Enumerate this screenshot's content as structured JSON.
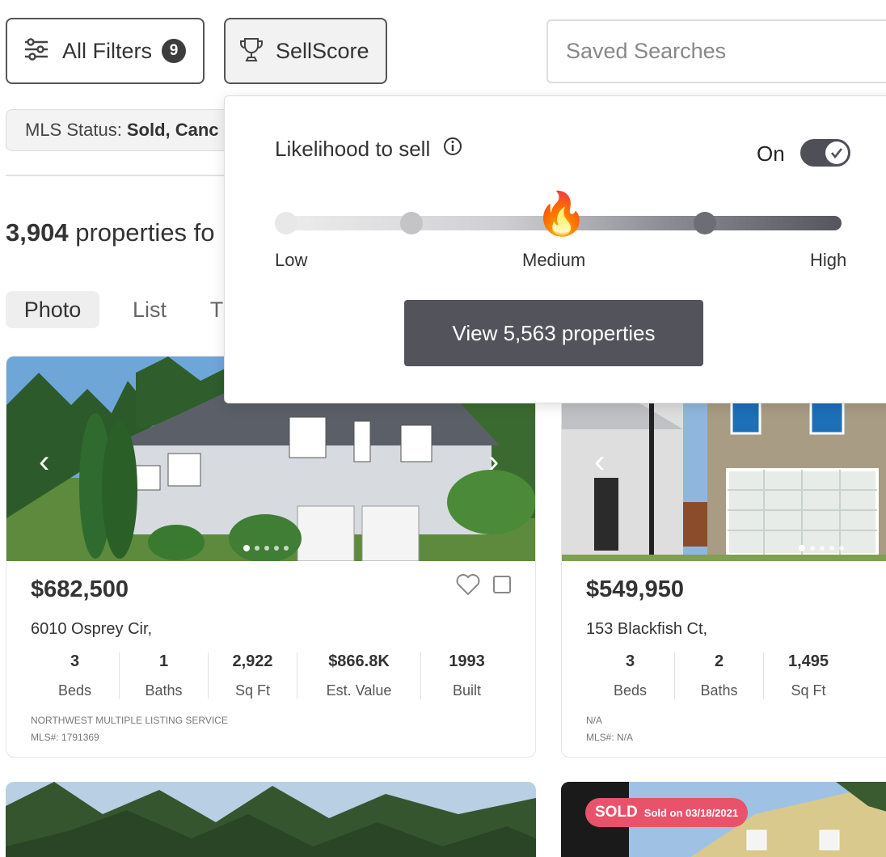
{
  "toolbar": {
    "filters_label": "All Filters",
    "filters_count": "9",
    "sellscore_label": "SellScore",
    "saved_searches_placeholder": "Saved Searches"
  },
  "chips": {
    "mls_status_key": "MLS Status:",
    "mls_status_value": "Sold, Canc"
  },
  "results": {
    "count": "3,904",
    "suffix": "properties fo"
  },
  "view_tabs": [
    "Photo",
    "List",
    "T"
  ],
  "sellscore_popover": {
    "title": "Likelihood to sell",
    "toggle_label": "On",
    "toggle_on": true,
    "slider_labels": {
      "low": "Low",
      "medium": "Medium",
      "high": "High"
    },
    "selected_level": "Medium",
    "view_button": "View 5,563 properties"
  },
  "listings": [
    {
      "price": "$682,500",
      "address": "6010 Osprey Cir,",
      "stats": [
        {
          "value": "3",
          "label": "Beds"
        },
        {
          "value": "1",
          "label": "Baths"
        },
        {
          "value": "2,922",
          "label": "Sq Ft"
        },
        {
          "value": "$866.8K",
          "label": "Est. Value"
        },
        {
          "value": "1993",
          "label": "Built"
        }
      ],
      "source": "NORTHWEST MULTIPLE LISTING SERVICE",
      "mls": "MLS#: 1791369"
    },
    {
      "price": "$549,950",
      "address": "153 Blackfish Ct,",
      "stats": [
        {
          "value": "3",
          "label": "Beds"
        },
        {
          "value": "2",
          "label": "Baths"
        },
        {
          "value": "1,495",
          "label": "Sq Ft"
        }
      ],
      "source": "N/A",
      "mls": "MLS#: N/A"
    }
  ],
  "sold_badge": {
    "label": "SOLD",
    "date": "Sold on 03/18/2021"
  },
  "colors": {
    "accent_dark": "#53535c",
    "sold_badge": "#e8536b"
  }
}
